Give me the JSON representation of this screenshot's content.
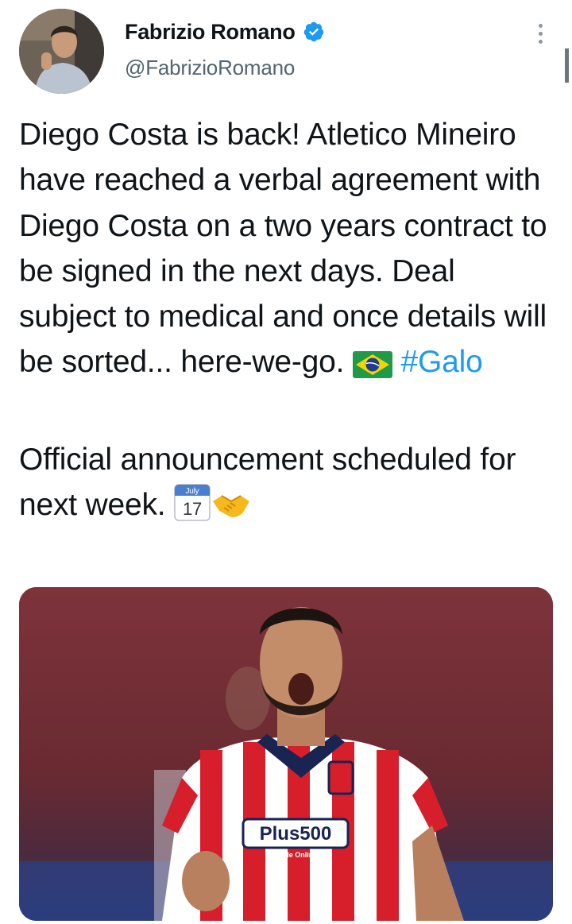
{
  "header": {
    "display_name": "Fabrizio Romano",
    "handle": "@FabrizioRomano"
  },
  "icons": {
    "avatar": "profile-photo",
    "verified": "verified-badge-icon",
    "more": "more-options-icon",
    "flag": "brazil-flag-icon",
    "calendar": "calendar-icon",
    "handshake": "handshake-icon"
  },
  "tweet": {
    "paragraph1": "Diego Costa is back! Atletico Mineiro have reached a verbal agreement with Diego Costa on a two years contract to be signed in the next days. Deal subject to medical and once details will be sorted... here-we-go.",
    "hashtag": "#Galo",
    "paragraph2": "Official announcement scheduled for next week.",
    "calendar_month": "July",
    "calendar_day": "17"
  },
  "media": {
    "sponsor_main": "Plus500",
    "sponsor_sub": "Trade Online"
  },
  "colors": {
    "accent": "#1d9bf0",
    "text": "#0f1419",
    "secondary": "#536471",
    "shirt_red": "#d71f2c"
  }
}
